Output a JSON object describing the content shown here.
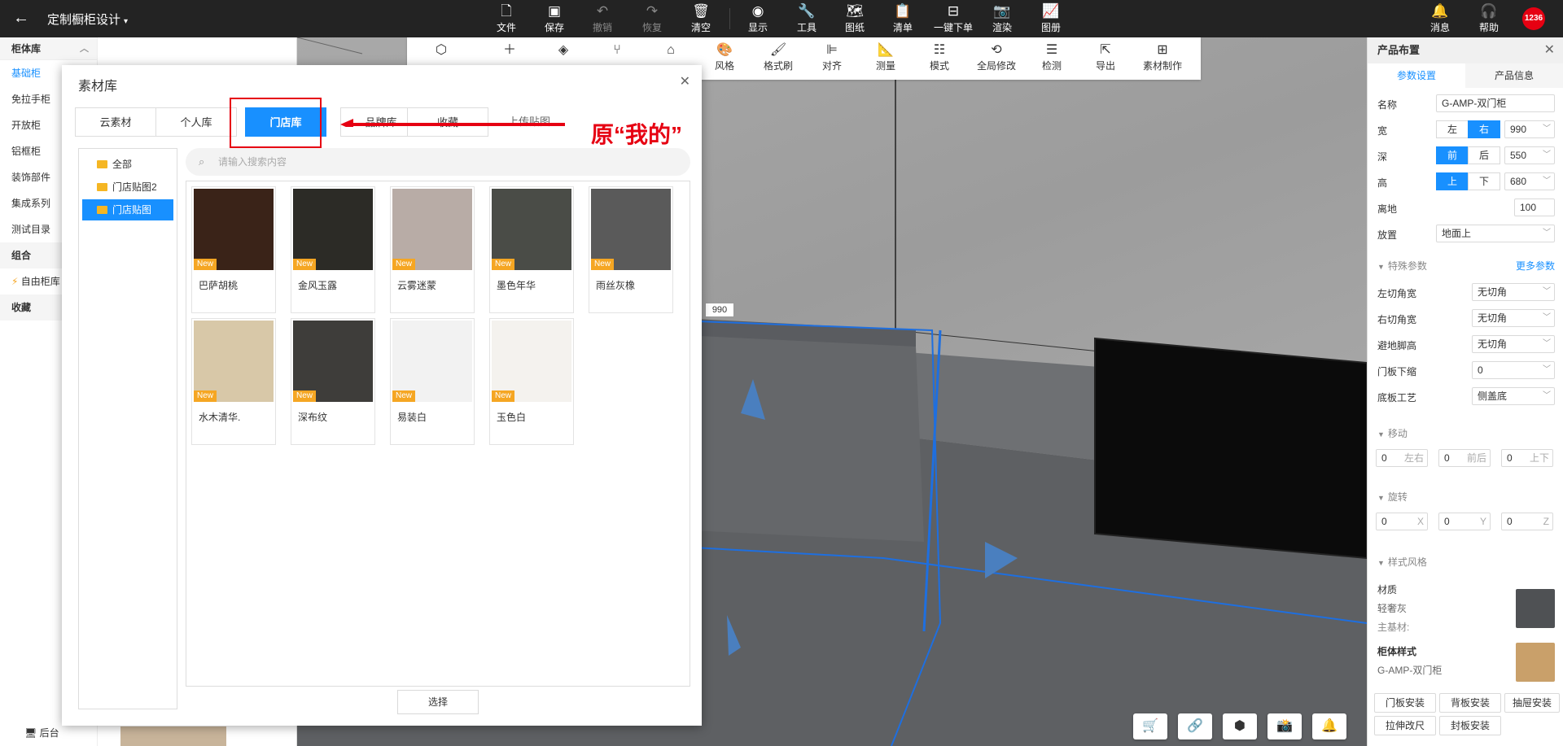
{
  "topbar": {
    "back_icon": "arrow-left-icon",
    "title": "定制橱柜设计",
    "tools": [
      {
        "label": "文件",
        "icon": "file-icon"
      },
      {
        "label": "保存",
        "icon": "save-icon"
      },
      {
        "label": "撤销",
        "icon": "undo-icon"
      },
      {
        "label": "恢复",
        "icon": "redo-icon"
      },
      {
        "label": "清空",
        "icon": "trash-icon"
      },
      {
        "label": "显示",
        "icon": "eye-icon"
      },
      {
        "label": "工具",
        "icon": "wrench-icon"
      },
      {
        "label": "图纸",
        "icon": "map-icon"
      },
      {
        "label": "清单",
        "icon": "clipboard-icon"
      },
      {
        "label": "一键下单",
        "icon": "order-icon"
      },
      {
        "label": "渲染",
        "icon": "camera-icon"
      },
      {
        "label": "图册",
        "icon": "album-icon"
      }
    ],
    "right": [
      {
        "label": "消息",
        "icon": "bell-icon"
      },
      {
        "label": "帮助",
        "icon": "headset-icon"
      }
    ],
    "avatar_text": "1236"
  },
  "left_panel": {
    "header": "柜体库",
    "items": [
      "基础柜",
      "免拉手柜",
      "开放柜",
      "铝框柜",
      "装饰部件",
      "集成系列",
      "测试目录"
    ],
    "active_item": "基础柜",
    "group_header": "组合",
    "group_item": "自由柜库",
    "fav_header": "收藏",
    "bottom_label": "后台"
  },
  "scene_toolbar": [
    {
      "label": "",
      "icon": "cube-icon"
    },
    {
      "label": "",
      "icon": "plus-icon"
    },
    {
      "label": "",
      "icon": "box-icon"
    },
    {
      "label": "",
      "icon": "chair-icon"
    },
    {
      "label": "",
      "icon": "shape-icon"
    },
    {
      "label": "风格",
      "icon": "palette-icon"
    },
    {
      "label": "格式刷",
      "icon": "brush-icon"
    },
    {
      "label": "对齐",
      "icon": "align-icon"
    },
    {
      "label": "测量",
      "icon": "ruler-icon"
    },
    {
      "label": "模式",
      "icon": "mode-icon"
    },
    {
      "label": "全局修改",
      "icon": "global-edit-icon"
    },
    {
      "label": "检测",
      "icon": "check-icon"
    },
    {
      "label": "导出",
      "icon": "export-icon"
    },
    {
      "label": "素材制作",
      "icon": "material-make-icon"
    }
  ],
  "scene": {
    "dim_label": "990"
  },
  "modal": {
    "title": "素材库",
    "tabs": [
      "云素材",
      "个人库",
      "门店库",
      "品牌库",
      "收藏",
      "上传贴图"
    ],
    "active_tab": "门店库",
    "folders": [
      "全部",
      "门店贴图2",
      "门店贴图"
    ],
    "active_folder": "门店贴图",
    "search_placeholder": "请输入搜索内容",
    "badge": "New",
    "materials": [
      {
        "name": "巴萨胡桃",
        "color": "#3a2318"
      },
      {
        "name": "金风玉露",
        "color": "#2c2b26"
      },
      {
        "name": "云雾迷蒙",
        "color": "#b8aca6"
      },
      {
        "name": "墨色年华",
        "color": "#4a4c47"
      },
      {
        "name": "雨丝灰橡",
        "color": "#5a5a5a"
      },
      {
        "name": "水木清华.",
        "color": "#d8c8a8"
      },
      {
        "name": "深布纹",
        "color": "#3e3d3a"
      },
      {
        "name": "易装白",
        "color": "#f2f2f2"
      },
      {
        "name": "玉色白",
        "color": "#f4f2ee"
      }
    ],
    "select_button": "选择"
  },
  "annotation": {
    "text": "原“我的”",
    "color": "#e60012"
  },
  "right_panel": {
    "title": "产品布置",
    "tabs": [
      "参数设置",
      "产品信息"
    ],
    "name_label": "名称",
    "name_value": "G-AMP-双门柜",
    "width": {
      "label": "宽",
      "opt1": "左",
      "opt2": "右",
      "selected": "右",
      "value": "990"
    },
    "depth": {
      "label": "深",
      "opt1": "前",
      "opt2": "后",
      "selected": "前",
      "value": "550"
    },
    "height": {
      "label": "高",
      "opt1": "上",
      "opt2": "下",
      "selected": "上",
      "value": "680"
    },
    "ground": {
      "label": "离地",
      "value": "100"
    },
    "place": {
      "label": "放置",
      "value": "地面上"
    },
    "special": {
      "title": "特殊参数",
      "more": "更多参数",
      "rows": [
        {
          "label": "左切角宽",
          "value": "无切角"
        },
        {
          "label": "右切角宽",
          "value": "无切角"
        },
        {
          "label": "避地脚高",
          "value": "无切角"
        },
        {
          "label": "门板下缩",
          "value": "0"
        },
        {
          "label": "底板工艺",
          "value": "侧盖底"
        }
      ]
    },
    "move": {
      "title": "移动",
      "fields": [
        {
          "value": "0",
          "unit": "左右"
        },
        {
          "value": "0",
          "unit": "前后"
        },
        {
          "value": "0",
          "unit": "上下"
        }
      ]
    },
    "rotate": {
      "title": "旋转",
      "fields": [
        {
          "value": "0",
          "unit": "X"
        },
        {
          "value": "0",
          "unit": "Y"
        },
        {
          "value": "0",
          "unit": "Z"
        }
      ]
    },
    "style": {
      "title": "样式风格",
      "material_label": "材质",
      "material_name": "轻奢灰",
      "base_label": "主基材:",
      "cabinet_style_label": "柜体样式",
      "cabinet_style_value": "G-AMP-双门柜",
      "material_color": "#4f5154",
      "cabinet_color": "#c9a06a"
    },
    "buttons": [
      "门板安装",
      "背板安装",
      "抽屉安装",
      "拉伸改尺",
      "封板安装"
    ]
  },
  "bottom_buttons": [
    {
      "icon": "cart-icon"
    },
    {
      "icon": "link-icon"
    },
    {
      "icon": "cube-view-icon"
    },
    {
      "icon": "snapshot-icon"
    },
    {
      "icon": "notify-icon"
    }
  ]
}
